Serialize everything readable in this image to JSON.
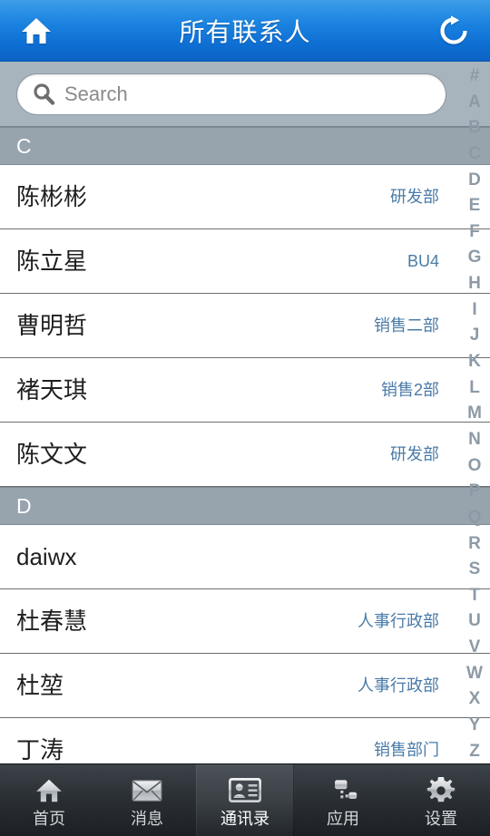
{
  "header": {
    "title": "所有联系人",
    "home_icon": "home-icon",
    "refresh_icon": "refresh-icon"
  },
  "search": {
    "placeholder": "Search",
    "value": "",
    "icon": "search-icon"
  },
  "alpha_index": [
    "#",
    "A",
    "B",
    "C",
    "D",
    "E",
    "F",
    "G",
    "H",
    "I",
    "J",
    "K",
    "L",
    "M",
    "N",
    "O",
    "P",
    "Q",
    "R",
    "S",
    "T",
    "U",
    "V",
    "W",
    "X",
    "Y",
    "Z"
  ],
  "sections": [
    {
      "letter": "C",
      "contacts": [
        {
          "name": "陈彬彬",
          "dept": "研发部"
        },
        {
          "name": "陈立星",
          "dept": "BU4"
        },
        {
          "name": "曹明哲",
          "dept": "销售二部"
        },
        {
          "name": "褚天琪",
          "dept": "销售2部"
        },
        {
          "name": "陈文文",
          "dept": "研发部"
        }
      ]
    },
    {
      "letter": "D",
      "contacts": [
        {
          "name": "daiwx",
          "dept": ""
        },
        {
          "name": "杜春慧",
          "dept": "人事行政部"
        },
        {
          "name": "杜堃",
          "dept": "人事行政部"
        },
        {
          "name": "丁涛",
          "dept": "销售部门"
        }
      ]
    }
  ],
  "tabbar": {
    "items": [
      {
        "label": "首页",
        "icon": "home-icon",
        "active": false
      },
      {
        "label": "消息",
        "icon": "envelope-icon",
        "active": false
      },
      {
        "label": "通讯录",
        "icon": "contact-card-icon",
        "active": true
      },
      {
        "label": "应用",
        "icon": "apps-node-icon",
        "active": false
      },
      {
        "label": "设置",
        "icon": "gear-icon",
        "active": false
      }
    ]
  },
  "colors": {
    "header_blue": "#1b83e0",
    "search_strip": "#a8b4bd",
    "section_header": "#97a3ad",
    "dept_text": "#4a7ba8",
    "index_text": "#8d9aa6",
    "tabbar": "#2b3035"
  }
}
